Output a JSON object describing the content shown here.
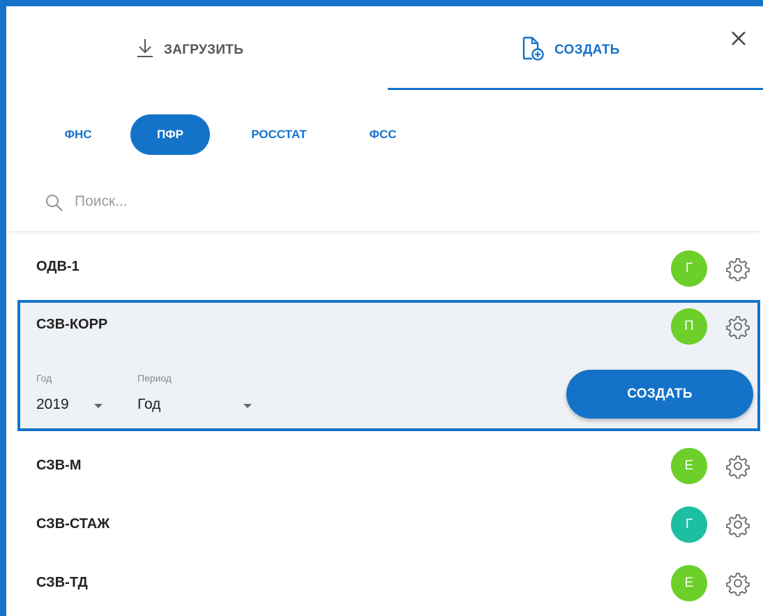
{
  "tabs": {
    "upload_label": "ЗАГРУЗИТЬ",
    "create_label": "СОЗДАТЬ",
    "active": "create"
  },
  "agencies": [
    {
      "label": "ФНС",
      "active": false
    },
    {
      "label": "ПФР",
      "active": true
    },
    {
      "label": "РОССТАТ",
      "active": false
    },
    {
      "label": "ФСС",
      "active": false
    }
  ],
  "search": {
    "placeholder": "Поиск...",
    "value": ""
  },
  "reports": [
    {
      "name": "ОДВ-1",
      "badge": "Г",
      "badge_color": "#6ccf2a"
    },
    {
      "name": "СЗВ-КОРР",
      "badge": "П",
      "badge_color": "#6ccf2a",
      "expanded": true
    },
    {
      "name": "СЗВ-М",
      "badge": "Е",
      "badge_color": "#6ccf2a"
    },
    {
      "name": "СЗВ-СТАЖ",
      "badge": "Г",
      "badge_color": "#1dbfa3"
    },
    {
      "name": "СЗВ-ТД",
      "badge": "Е",
      "badge_color": "#6ccf2a"
    }
  ],
  "expanded": {
    "year_label": "Год",
    "year_value": "2019",
    "period_label": "Период",
    "period_value": "Год",
    "create_button": "СОЗДАТЬ"
  },
  "colors": {
    "accent": "#1473c9",
    "badge_green": "#6ccf2a",
    "badge_teal": "#1dbfa3"
  }
}
